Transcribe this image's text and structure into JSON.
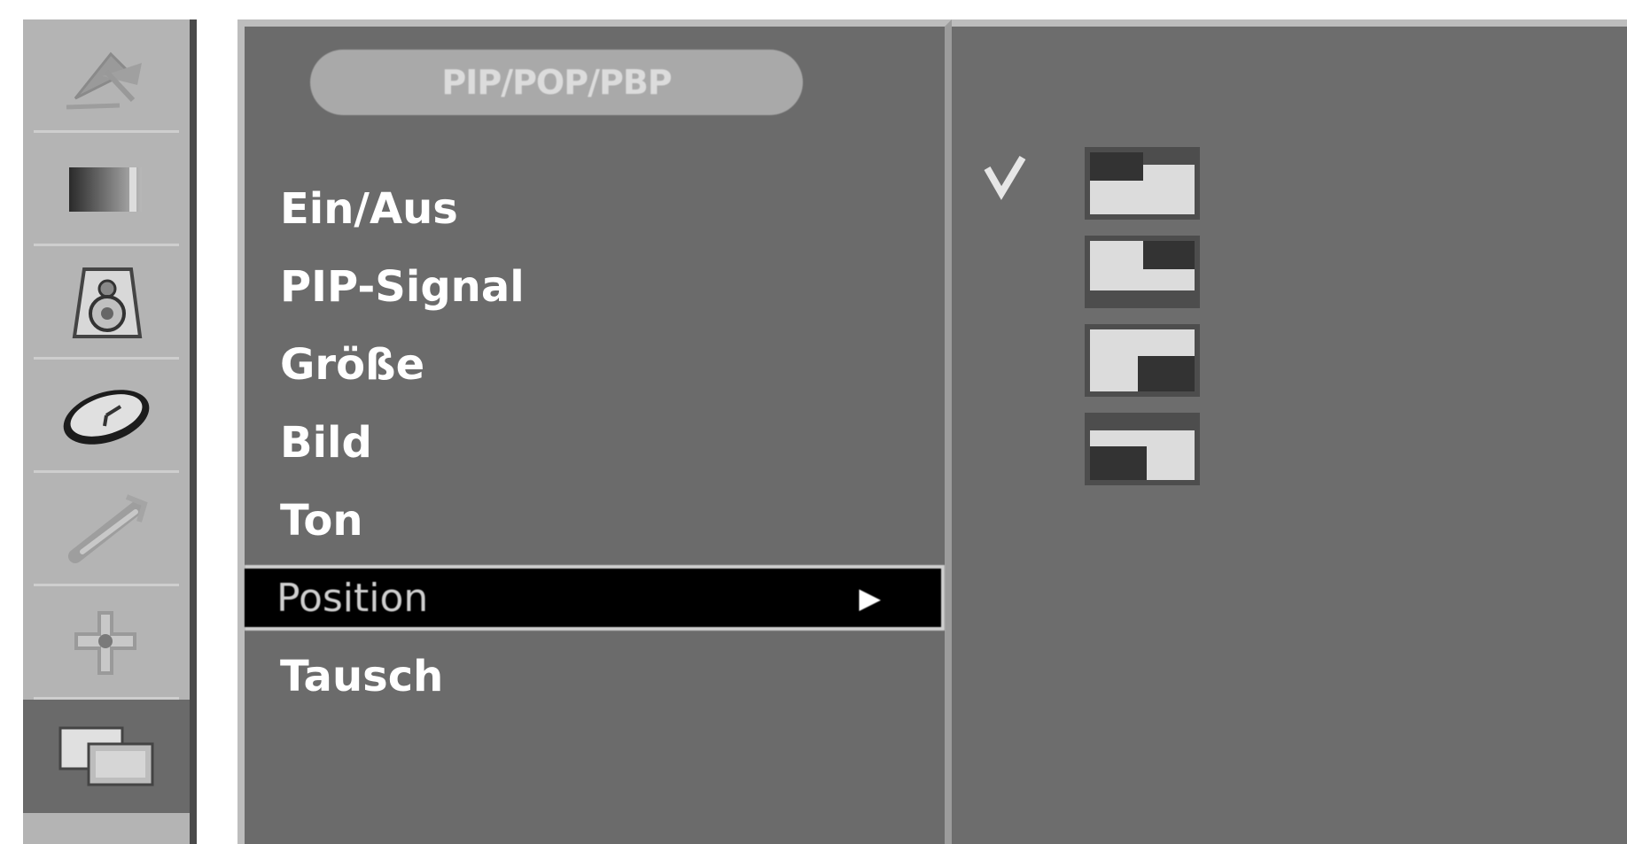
{
  "sidebar": {
    "items": [
      {
        "icon": "satellite-dish-icon"
      },
      {
        "icon": "picture-icon"
      },
      {
        "icon": "speaker-icon"
      },
      {
        "icon": "clock-icon"
      },
      {
        "icon": "wrench-icon"
      },
      {
        "icon": "joystick-icon"
      },
      {
        "icon": "pip-screens-icon",
        "active": true
      }
    ]
  },
  "menu": {
    "title": "PIP/POP/PBP",
    "items": [
      {
        "label": "Ein/Aus"
      },
      {
        "label": "PIP-Signal"
      },
      {
        "label": "Größe"
      },
      {
        "label": "Bild"
      },
      {
        "label": "Ton"
      },
      {
        "label": "Position",
        "selected": true,
        "arrow": "▶"
      },
      {
        "label": "Tausch"
      }
    ]
  },
  "submenu": {
    "check_mark": "✓",
    "options": [
      {
        "icon": "pip-position-top-right-icon",
        "checked": true
      },
      {
        "icon": "pip-position-bottom-right-icon"
      },
      {
        "icon": "pip-position-bottom-left-icon"
      },
      {
        "icon": "pip-position-top-left-icon"
      }
    ]
  },
  "colors": {
    "panel_gray": "#6b6b6b",
    "sidebar_gray": "#b4b4b4",
    "highlight": "#000000",
    "text": "#ffffff"
  }
}
